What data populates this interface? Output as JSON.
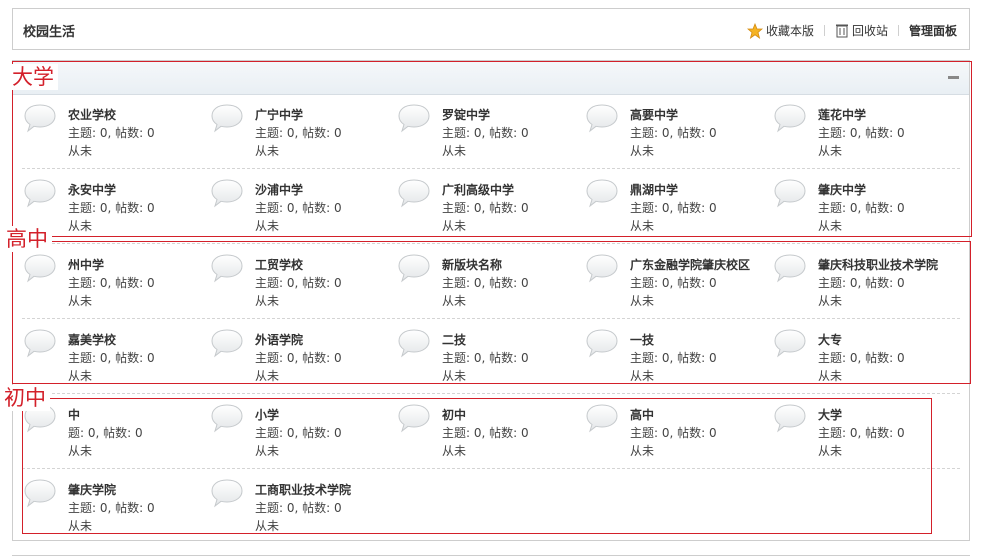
{
  "header": {
    "title": "校园生活",
    "favorite_label": "收藏本版",
    "recycle_label": "回收站",
    "manage_label": "管理面板"
  },
  "forums": [
    {
      "name": "农业学校",
      "stats": "主题: 0, 帖数: 0",
      "last": "从未"
    },
    {
      "name": "广宁中学",
      "stats": "主题: 0, 帖数: 0",
      "last": "从未"
    },
    {
      "name": "罗锭中学",
      "stats": "主题: 0, 帖数: 0",
      "last": "从未"
    },
    {
      "name": "高要中学",
      "stats": "主题: 0, 帖数: 0",
      "last": "从未"
    },
    {
      "name": "莲花中学",
      "stats": "主题: 0, 帖数: 0",
      "last": "从未"
    },
    {
      "name": "永安中学",
      "stats": "主题: 0, 帖数: 0",
      "last": "从未"
    },
    {
      "name": "沙浦中学",
      "stats": "主题: 0, 帖数: 0",
      "last": "从未"
    },
    {
      "name": "广利高级中学",
      "stats": "主题: 0, 帖数: 0",
      "last": "从未"
    },
    {
      "name": "鼎湖中学",
      "stats": "主题: 0, 帖数: 0",
      "last": "从未"
    },
    {
      "name": "肇庆中学",
      "stats": "主题: 0, 帖数: 0",
      "last": "从未"
    },
    {
      "name": "州中学",
      "stats": "主题: 0, 帖数: 0",
      "last": "从未"
    },
    {
      "name": "工贸学校",
      "stats": "主题: 0, 帖数: 0",
      "last": "从未"
    },
    {
      "name": "新版块名称",
      "stats": "主题: 0, 帖数: 0",
      "last": "从未"
    },
    {
      "name": "广东金融学院肇庆校区",
      "stats": "主题: 0, 帖数: 0",
      "last": "从未"
    },
    {
      "name": "肇庆科技职业技术学院",
      "stats": "主题: 0, 帖数: 0",
      "last": "从未"
    },
    {
      "name": "嘉美学校",
      "stats": "主题: 0, 帖数: 0",
      "last": "从未"
    },
    {
      "name": "外语学院",
      "stats": "主题: 0, 帖数: 0",
      "last": "从未"
    },
    {
      "name": "二技",
      "stats": "主题: 0, 帖数: 0",
      "last": "从未"
    },
    {
      "name": "一技",
      "stats": "主题: 0, 帖数: 0",
      "last": "从未"
    },
    {
      "name": "大专",
      "stats": "主题: 0, 帖数: 0",
      "last": "从未"
    },
    {
      "name": "中",
      "stats": "题: 0, 帖数: 0",
      "last": "从未"
    },
    {
      "name": "小学",
      "stats": "主题: 0, 帖数: 0",
      "last": "从未"
    },
    {
      "name": "初中",
      "stats": "主题: 0, 帖数: 0",
      "last": "从未"
    },
    {
      "name": "高中",
      "stats": "主题: 0, 帖数: 0",
      "last": "从未"
    },
    {
      "name": "大学",
      "stats": "主题: 0, 帖数: 0",
      "last": "从未"
    },
    {
      "name": "肇庆学院",
      "stats": "主题: 0, 帖数: 0",
      "last": "从未"
    },
    {
      "name": "工商职业技术学院",
      "stats": "主题: 0, 帖数: 0",
      "last": "从未"
    }
  ],
  "annotations": {
    "university": "大学",
    "high_school": "高中",
    "middle_school": "初中"
  },
  "colors": {
    "annotation_red": "#d3202a",
    "border_gray": "#cdcdcd"
  },
  "icons": {
    "favorite": "star-icon",
    "recycle": "trash-icon",
    "forum": "speech-bubble-icon",
    "collapse": "minus-icon"
  }
}
